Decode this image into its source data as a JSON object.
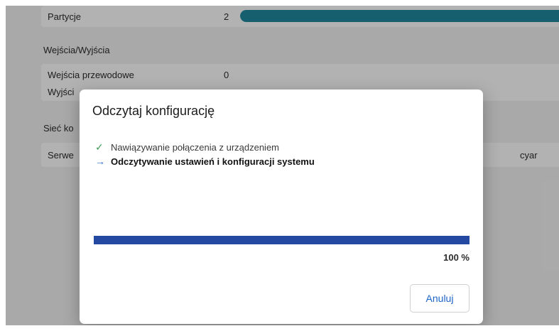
{
  "background": {
    "partitions": {
      "label": "Partycje",
      "value": "2",
      "fill_percent": 100
    },
    "io_section": "Wejścia/Wyjścia",
    "wired_inputs": {
      "label": "Wejścia przewodowe",
      "value": "0"
    },
    "outputs": {
      "label": "Wyjści"
    },
    "network_section": "Sieć ko",
    "server": {
      "label": "Serwe",
      "value": "cyar"
    }
  },
  "dialog": {
    "title": "Odczytaj konfigurację",
    "steps": [
      {
        "icon": "checkmark-icon",
        "status": "done",
        "text": "Nawiązywanie połączenia z urządzeniem"
      },
      {
        "icon": "arrow-right-icon",
        "status": "active",
        "text": "Odczytywanie ustawień i konfiguracji systemu"
      }
    ],
    "progress": {
      "value": 100,
      "label": "100 %"
    },
    "cancel_label": "Anuluj"
  },
  "colors": {
    "accent": "#2449a3",
    "partition_bar": "#1f88a0",
    "check": "#3d9b54",
    "arrow": "#2e6fd0",
    "button_text": "#1d64c7"
  }
}
